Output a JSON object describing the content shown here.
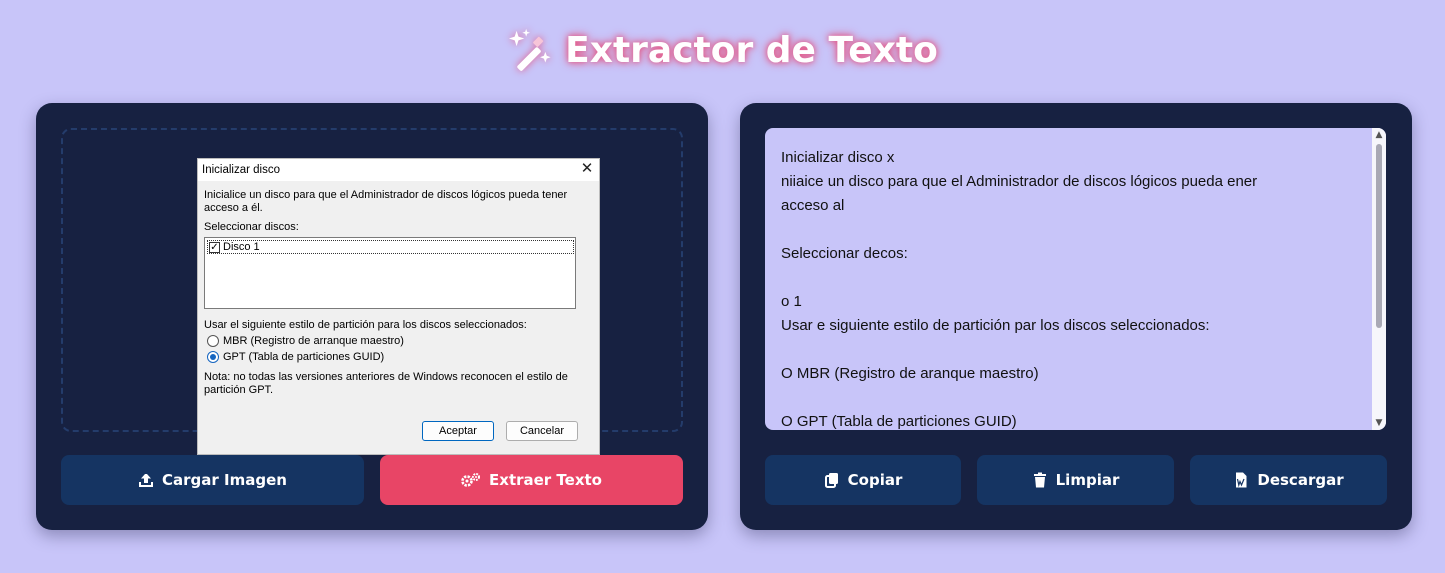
{
  "app": {
    "title": "Extractor de Texto",
    "icon": "magic-wand-icon"
  },
  "colors": {
    "background": "#c8c5f9",
    "panel": "#172141",
    "primary_button": "#153462",
    "accent_button": "#e84566"
  },
  "left_panel": {
    "image_preview": {
      "dialog_title": "Inicializar disco",
      "intro": "Inicialice un disco para que el Administrador de discos lógicos pueda tener acceso a él.",
      "select_label": "Seleccionar discos:",
      "disk_item": "Disco 1",
      "partition_label": "Usar el siguiente estilo de partición para los discos seleccionados:",
      "option_mbr": "MBR (Registro de arranque maestro)",
      "option_gpt": "GPT (Tabla de particiones GUID)",
      "selected_option": "GPT",
      "note": "Nota: no todas las versiones anteriores de Windows reconocen el estilo de partición GPT.",
      "ok_label": "Aceptar",
      "cancel_label": "Cancelar"
    },
    "upload_button": "Cargar Imagen",
    "extract_button": "Extraer Texto"
  },
  "right_panel": {
    "extracted_text": "Inicializar disco x\nniiaice un disco para que el Administrador de discos lógicos pueda ener\nacceso al\n\nSeleccionar decos:\n\no 1\nUsar e siguiente estilo de partición par los discos seleccionados:\n\nO MBR (Registro de aranque maestro)\n\nO GPT (Tabla de particiones GUID)",
    "copy_button": "Copiar",
    "clear_button": "Limpiar",
    "download_button": "Descargar"
  }
}
